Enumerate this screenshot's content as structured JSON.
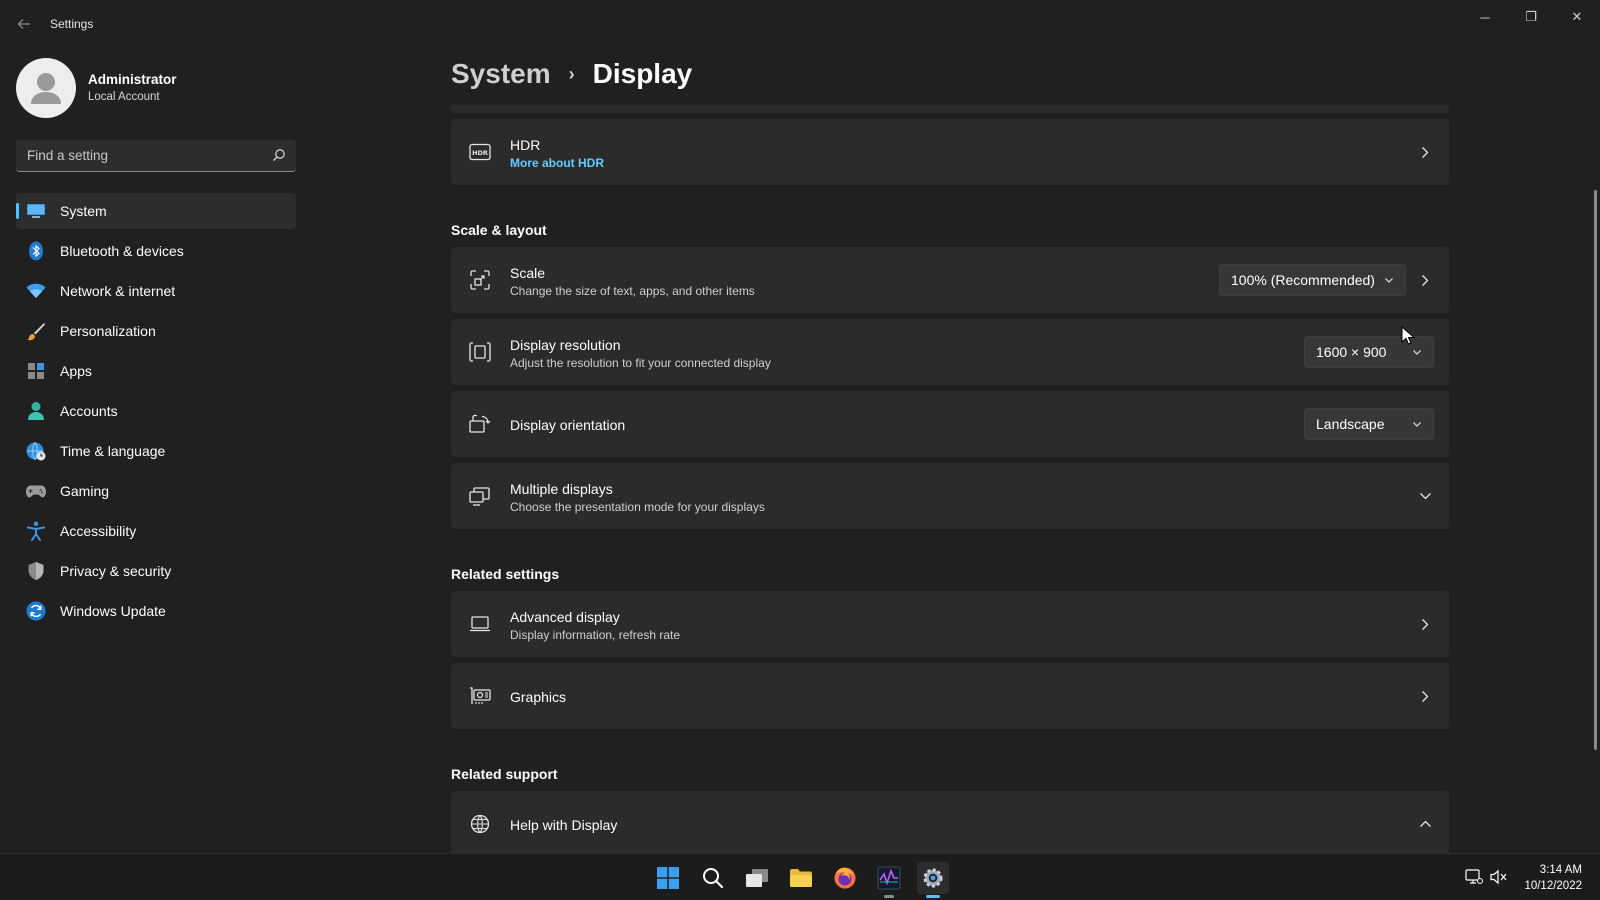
{
  "window": {
    "app_title": "Settings",
    "controls": {
      "minimize": "─",
      "maximize": "❐",
      "close": "✕"
    }
  },
  "user": {
    "name": "Administrator",
    "account_type": "Local Account"
  },
  "search": {
    "placeholder": "Find a setting",
    "value": ""
  },
  "nav": {
    "items": [
      {
        "label": "System",
        "icon": "monitor-icon",
        "active": true
      },
      {
        "label": "Bluetooth & devices",
        "icon": "bluetooth-icon"
      },
      {
        "label": "Network & internet",
        "icon": "wifi-icon"
      },
      {
        "label": "Personalization",
        "icon": "brush-icon"
      },
      {
        "label": "Apps",
        "icon": "apps-icon"
      },
      {
        "label": "Accounts",
        "icon": "person-icon"
      },
      {
        "label": "Time & language",
        "icon": "globe-clock-icon"
      },
      {
        "label": "Gaming",
        "icon": "gamepad-icon"
      },
      {
        "label": "Accessibility",
        "icon": "accessibility-icon"
      },
      {
        "label": "Privacy & security",
        "icon": "shield-icon"
      },
      {
        "label": "Windows Update",
        "icon": "update-icon"
      }
    ]
  },
  "breadcrumb": {
    "parent": "System",
    "separator": "›",
    "current": "Display"
  },
  "hdr": {
    "title": "HDR",
    "link": "More about HDR",
    "icon_text": "HDR"
  },
  "sections": {
    "scale_layout": "Scale & layout",
    "related_settings": "Related settings",
    "related_support": "Related support"
  },
  "scale": {
    "title": "Scale",
    "subtitle": "Change the size of text, apps, and other items",
    "value": "100% (Recommended)"
  },
  "resolution": {
    "title": "Display resolution",
    "subtitle": "Adjust the resolution to fit your connected display",
    "value": "1600 × 900"
  },
  "orientation": {
    "title": "Display orientation",
    "value": "Landscape"
  },
  "multiple": {
    "title": "Multiple displays",
    "subtitle": "Choose the presentation mode for your displays"
  },
  "advanced": {
    "title": "Advanced display",
    "subtitle": "Display information, refresh rate"
  },
  "graphics": {
    "title": "Graphics"
  },
  "help": {
    "title": "Help with Display"
  },
  "taskbar": {
    "time": "3:14 AM",
    "date": "10/12/2022"
  },
  "colors": {
    "accent": "#4cc2ff",
    "link": "#60cdff",
    "card": "#2b2b2b",
    "background": "#202020"
  }
}
